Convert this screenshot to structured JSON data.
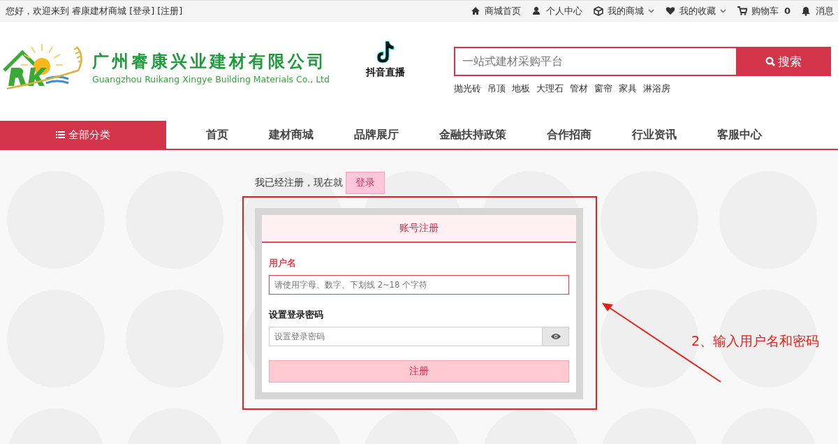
{
  "top_bar": {
    "greeting": "您好，欢迎来到 睿康建材商城",
    "login_link": "[登录]",
    "register_link": "[注册]",
    "links": [
      {
        "kind": "home",
        "label": "商城首页",
        "dropdown": false
      },
      {
        "kind": "user",
        "label": "个人中心",
        "dropdown": false
      },
      {
        "kind": "box",
        "label": "我的商城",
        "dropdown": true
      },
      {
        "kind": "heart",
        "label": "我的收藏",
        "dropdown": true
      },
      {
        "kind": "cart",
        "label": "购物车",
        "dropdown": false,
        "count": "0"
      },
      {
        "kind": "bell",
        "label": "消息",
        "dropdown": false
      }
    ]
  },
  "header": {
    "company_name": "广州睿康兴业建材有限公司",
    "company_english": "Guangzhou Ruikang Xingye Building Materials Co., Ltd",
    "live_label": "抖音直播",
    "search": {
      "placeholder": "一站式建材采购平台",
      "button": "搜索"
    },
    "hot_words": [
      "抛光砖",
      "吊顶",
      "地板",
      "大理石",
      "管材",
      "窗帘",
      "家具",
      "淋浴房"
    ]
  },
  "nav": {
    "category_button": "全部分类",
    "items": [
      "首页",
      "建材商城",
      "品牌展厅",
      "金融扶持政策",
      "合作招商",
      "行业资讯",
      "客服中心"
    ]
  },
  "login_prompt": {
    "text": "我已经注册，现在就",
    "button": "登录"
  },
  "form": {
    "tabs": [
      {
        "label": "账号注册",
        "selected": true
      }
    ],
    "fields": [
      {
        "kind": "text",
        "label": "用户名",
        "placeholder": "请使用字母、数字、下划线 2~18 个字符",
        "focused": true
      },
      {
        "kind": "password",
        "label": "设置登录密码",
        "placeholder": "设置登录密码",
        "focused": false
      }
    ],
    "submit": "注册"
  },
  "annotation": {
    "text": "2、输入用户名和密码"
  }
}
